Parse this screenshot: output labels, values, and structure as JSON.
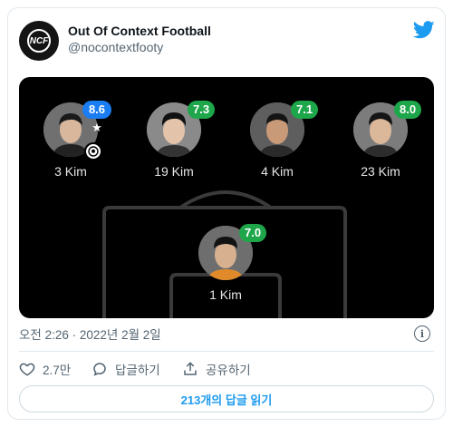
{
  "account": {
    "name": "Out Of Context Football",
    "handle": "@nocontextfooty",
    "avatar_text": "NCF"
  },
  "players": [
    {
      "label": "3 Kim",
      "rating": "8.6 ★",
      "badge_color": "#1a7df2",
      "has_goal": true
    },
    {
      "label": "19 Kim",
      "rating": "7.3",
      "badge_color": "#1ea64a",
      "has_goal": false
    },
    {
      "label": "4 Kim",
      "rating": "7.1",
      "badge_color": "#1ea64a",
      "has_goal": false
    },
    {
      "label": "23 Kim",
      "rating": "8.0",
      "badge_color": "#1ea64a",
      "has_goal": false
    },
    {
      "label": "1 Kim",
      "rating": "7.0",
      "badge_color": "#1ea64a",
      "has_goal": false
    }
  ],
  "timestamp": "오전 2:26 · 2022년 2월 2일",
  "actions": {
    "like_count": "2.7만",
    "reply_label": "답글하기",
    "share_label": "공유하기"
  },
  "replies_button": "213개의 답글 읽기",
  "colors": {
    "accent": "#1d9bf0",
    "rating_green": "#1ea64a",
    "rating_blue": "#1a7df2"
  }
}
